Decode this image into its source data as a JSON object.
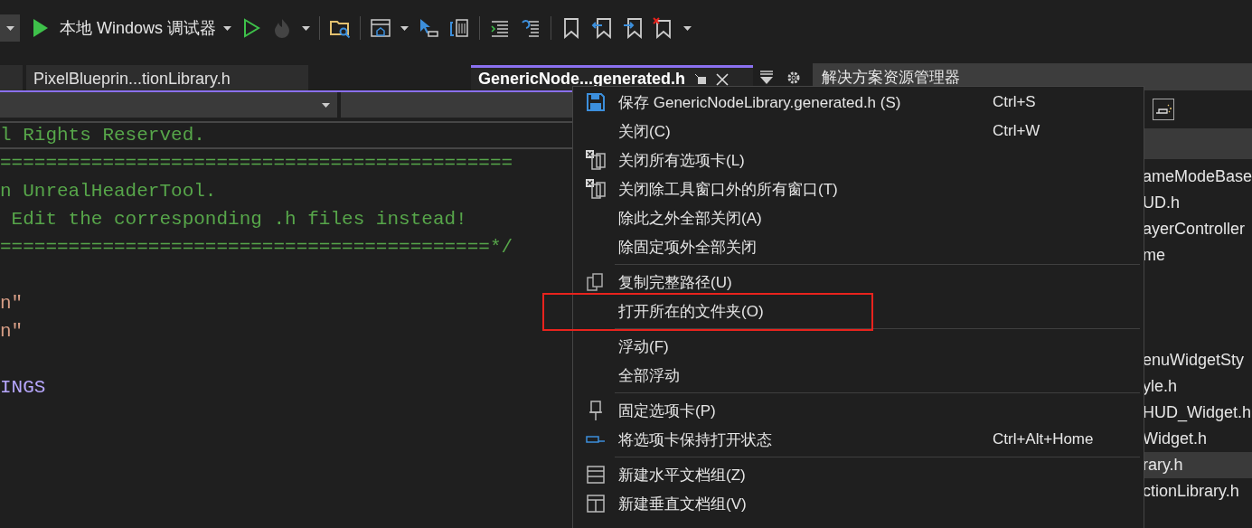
{
  "toolbar": {
    "debugger_label": "本地 Windows 调试器"
  },
  "editor_tabs": [
    {
      "label": "PixelBlueprin...tionLibrary.h",
      "selected": false
    },
    {
      "label": "GenericNode...generated.h",
      "selected": true
    }
  ],
  "code_lines": [
    {
      "current": true,
      "segments": [
        {
          "kind": "comment",
          "text": "l Rights Reserved."
        }
      ]
    },
    {
      "current": false,
      "segments": [
        {
          "kind": "comment",
          "text": "============================================="
        }
      ]
    },
    {
      "current": false,
      "segments": [
        {
          "kind": "comment",
          "text": "n UnrealHeaderTool."
        }
      ]
    },
    {
      "current": false,
      "segments": [
        {
          "kind": "comment",
          "text": " Edit the corresponding .h files instead!"
        }
      ]
    },
    {
      "current": false,
      "segments": [
        {
          "kind": "comment",
          "text": "===========================================*/"
        }
      ]
    },
    {
      "current": false
    },
    {
      "current": false,
      "segments": [
        {
          "kind": "string",
          "text": "n\""
        }
      ]
    },
    {
      "current": false,
      "segments": [
        {
          "kind": "string",
          "text": "n\""
        }
      ]
    },
    {
      "current": false
    },
    {
      "current": false,
      "segments": [
        {
          "kind": "macro",
          "text": "INGS"
        }
      ]
    }
  ],
  "solution_explorer": {
    "title": "解决方案资源管理器",
    "items": [
      {
        "label": "ameModeBase",
        "selected": false
      },
      {
        "label": "UD.h",
        "selected": false
      },
      {
        "label": "ayerController",
        "selected": false
      },
      {
        "label": "me",
        "selected": false
      },
      {
        "selected": false
      },
      {
        "selected": false
      },
      {
        "selected": false
      },
      {
        "label": "enuWidgetSty",
        "selected": false
      },
      {
        "label": "yle.h",
        "selected": false
      },
      {
        "label": "HUD_Widget.h",
        "selected": false
      },
      {
        "label": "Widget.h",
        "selected": false
      },
      {
        "label": "rary.h",
        "selected": true
      },
      {
        "label": "ctionLibrary.h",
        "selected": false
      }
    ]
  },
  "context_menu": {
    "groups": [
      [
        {
          "label": "保存 GenericNodeLibrary.generated.h (S)",
          "shortcut": "Ctrl+S",
          "highlighted": false
        },
        {
          "label": "关闭(C)",
          "shortcut": "Ctrl+W",
          "highlighted": false
        },
        {
          "label": "关闭所有选项卡(L)",
          "highlighted": false
        },
        {
          "label": "关闭除工具窗口外的所有窗口(T)",
          "highlighted": false
        },
        {
          "label": "除此之外全部关闭(A)",
          "highlighted": false
        },
        {
          "label": "除固定项外全部关闭",
          "highlighted": false
        }
      ],
      [
        {
          "label": "复制完整路径(U)",
          "highlighted": false
        },
        {
          "label": "打开所在的文件夹(O)",
          "highlighted": true
        }
      ],
      [
        {
          "label": "浮动(F)",
          "highlighted": false
        },
        {
          "label": "全部浮动",
          "highlighted": false
        }
      ],
      [
        {
          "label": "固定选项卡(P)",
          "highlighted": false
        },
        {
          "label": "将选项卡保持打开状态",
          "shortcut": "Ctrl+Alt+Home",
          "highlighted": false
        }
      ],
      [
        {
          "label": "新建水平文档组(Z)",
          "highlighted": false
        },
        {
          "label": "新建垂直文档组(V)",
          "highlighted": false
        }
      ]
    ]
  }
}
